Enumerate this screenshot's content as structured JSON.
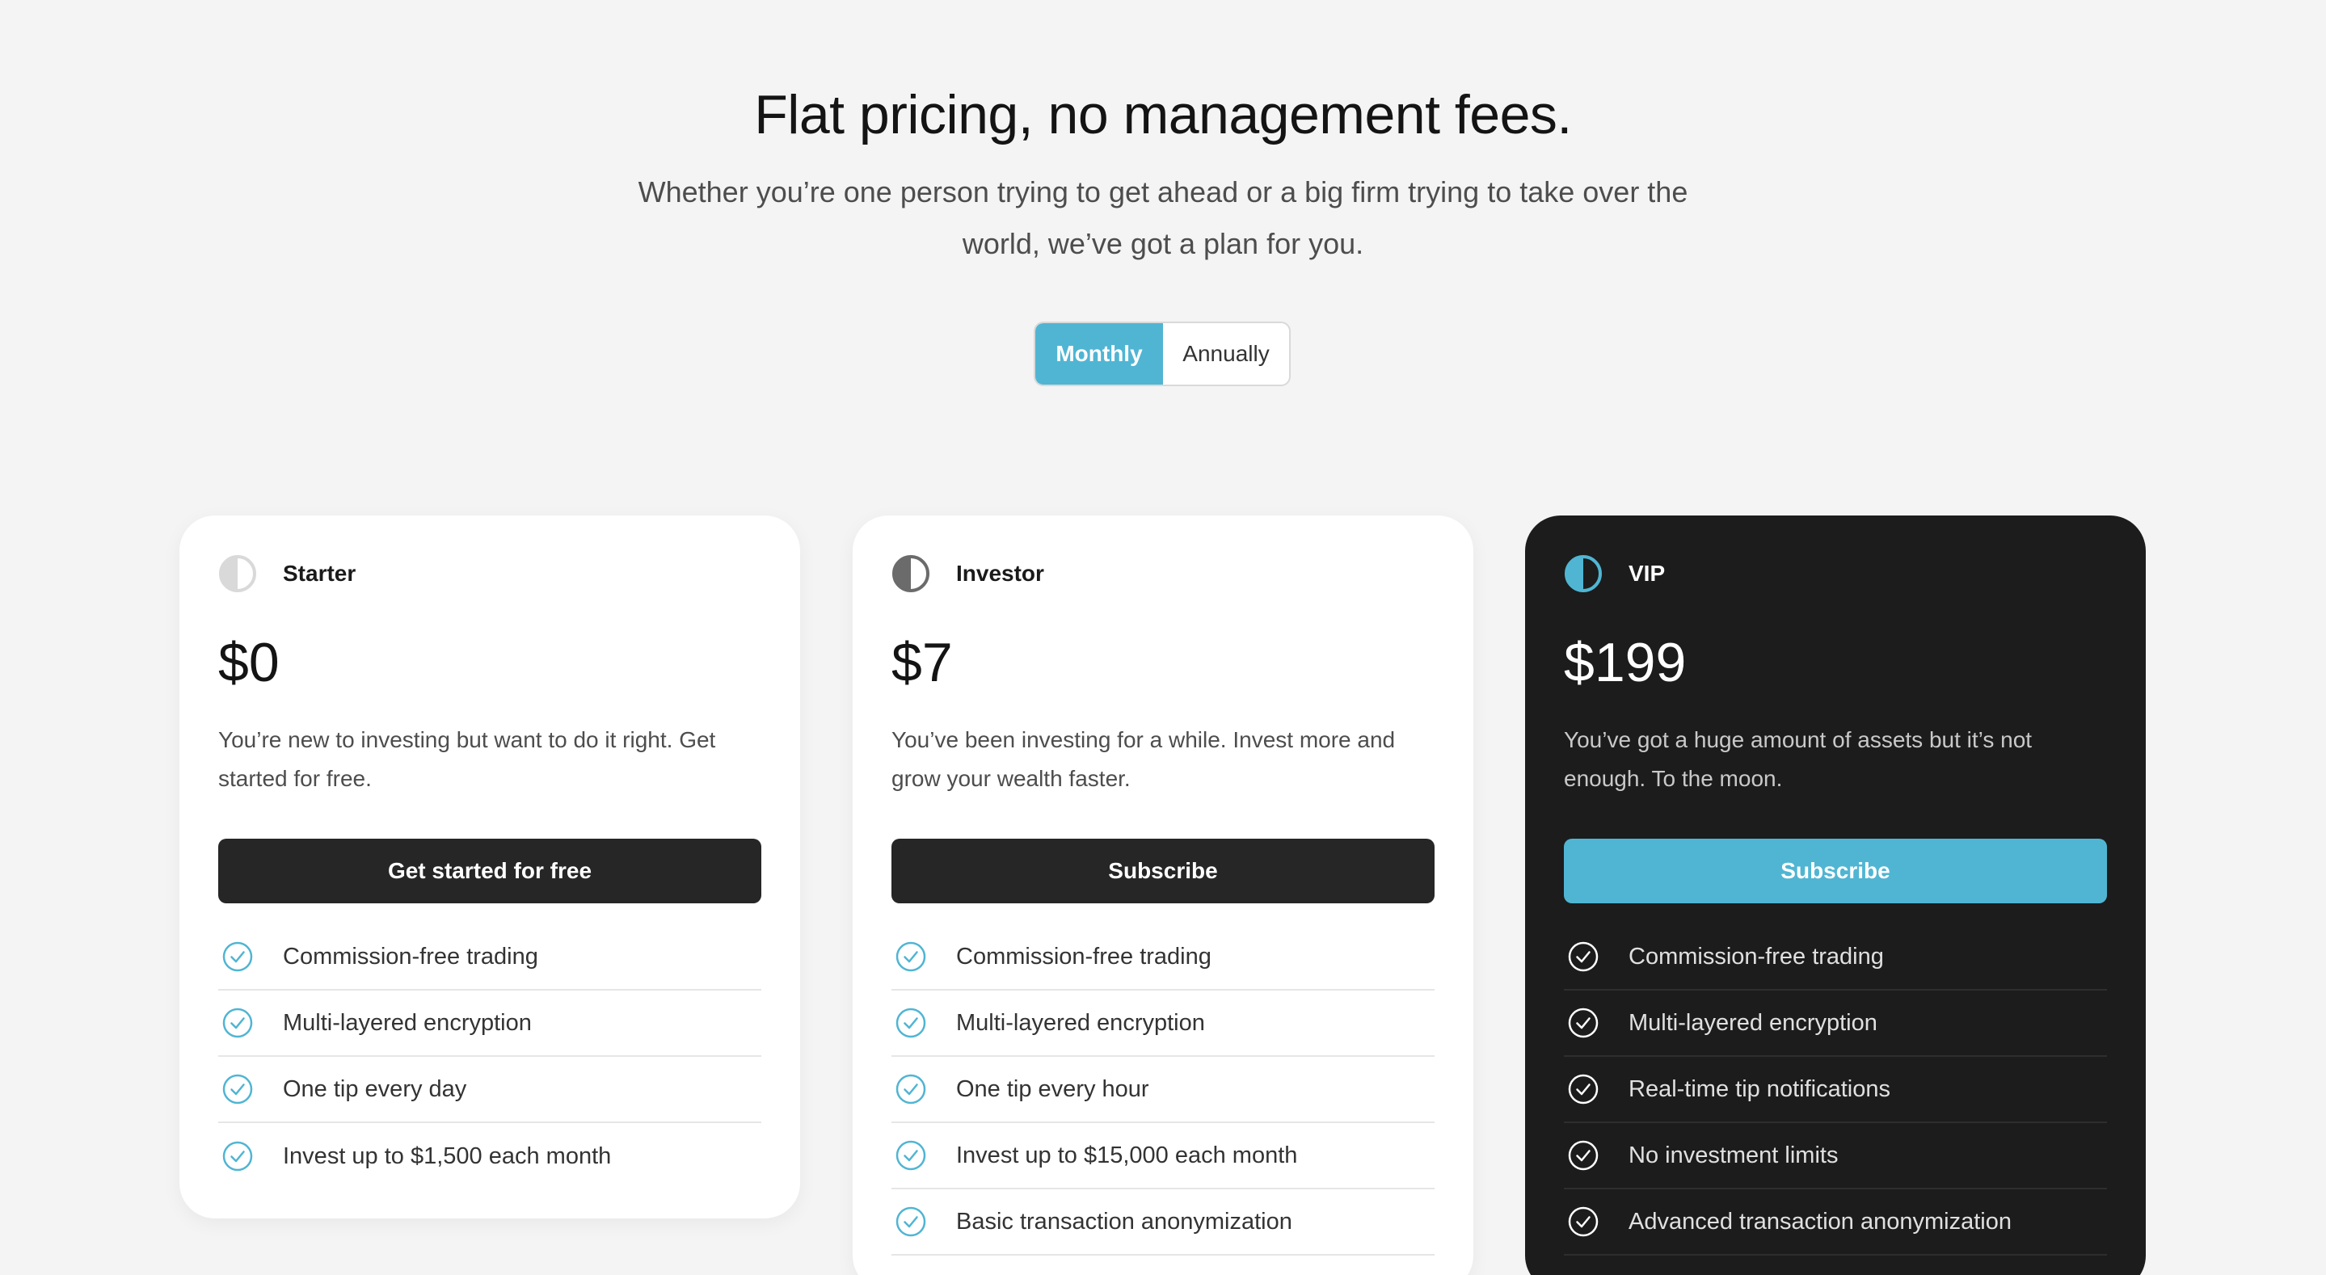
{
  "hero": {
    "title": "Flat pricing, no management fees.",
    "subtitle": "Whether you’re one person trying to get ahead or a big firm trying to take over the world, we’ve got a plan for you."
  },
  "billing_toggle": {
    "options": [
      "Monthly",
      "Annually"
    ],
    "selected": "Monthly"
  },
  "colors": {
    "accent": "#50b5d3",
    "dark_card": "#1c1c1c",
    "button_dark": "#262626",
    "background": "#f4f4f4"
  },
  "plans": [
    {
      "name": "Starter",
      "icon": "half-circle-light-icon",
      "price": "$0",
      "description": "You’re new to investing but want to do it right. Get started for free.",
      "cta": "Get started for free",
      "features": [
        "Commission-free trading",
        "Multi-layered encryption",
        "One tip every day",
        "Invest up to $1,500 each month"
      ]
    },
    {
      "name": "Investor",
      "icon": "half-circle-gray-icon",
      "price": "$7",
      "description": "You’ve been investing for a while. Invest more and grow your wealth faster.",
      "cta": "Subscribe",
      "features": [
        "Commission-free trading",
        "Multi-layered encryption",
        "One tip every hour",
        "Invest up to $15,000 each month",
        "Basic transaction anonymization"
      ]
    },
    {
      "name": "VIP",
      "icon": "half-circle-blue-icon",
      "price": "$199",
      "description": "You’ve got a huge amount of assets but it’s not enough. To the moon.",
      "cta": "Subscribe",
      "features": [
        "Commission-free trading",
        "Multi-layered encryption",
        "Real-time tip notifications",
        "No investment limits",
        "Advanced transaction anonymization"
      ]
    }
  ]
}
